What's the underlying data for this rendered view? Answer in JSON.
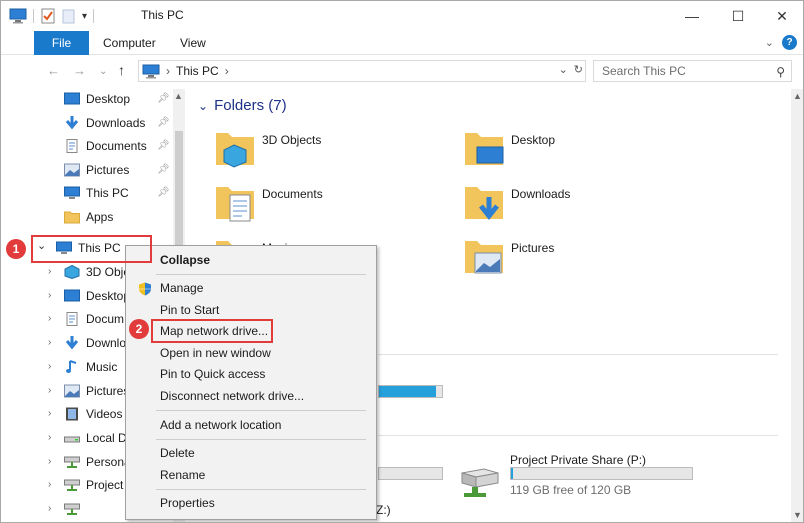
{
  "window": {
    "title": "This PC",
    "minimize": "—",
    "maximize": "☐",
    "close": "✕"
  },
  "ribbon": {
    "tabs": [
      "File",
      "Computer",
      "View"
    ]
  },
  "address": {
    "crumb": "This PC",
    "search_placeholder": "Search This PC"
  },
  "nav_pane": {
    "quick_access": [
      {
        "label": "Desktop",
        "icon": "desktop-icon"
      },
      {
        "label": "Downloads",
        "icon": "download-icon"
      },
      {
        "label": "Documents",
        "icon": "documents-icon"
      },
      {
        "label": "Pictures",
        "icon": "pictures-icon"
      },
      {
        "label": "This PC",
        "icon": "computer-icon"
      },
      {
        "label": "Apps",
        "icon": "folder-icon"
      }
    ],
    "this_pc": {
      "label": "This PC",
      "icon": "computer-icon"
    },
    "children": [
      {
        "label": "3D Obje",
        "icon": "3d-objects-icon"
      },
      {
        "label": "Desktop",
        "icon": "desktop-icon"
      },
      {
        "label": "Docum",
        "icon": "documents-icon"
      },
      {
        "label": "Downlo",
        "icon": "download-icon"
      },
      {
        "label": "Music",
        "icon": "music-icon"
      },
      {
        "label": "Pictures",
        "icon": "pictures-icon"
      },
      {
        "label": "Videos",
        "icon": "videos-icon"
      },
      {
        "label": "Local D",
        "icon": "drive-icon"
      },
      {
        "label": "Persona",
        "icon": "network-drive-icon"
      },
      {
        "label": "Project",
        "icon": "network-drive-icon"
      },
      {
        "label": "",
        "icon": "network-drive-icon"
      }
    ]
  },
  "content": {
    "folders_header": "Folders (7)",
    "folders": [
      {
        "label": "3D Objects"
      },
      {
        "label": "Desktop"
      },
      {
        "label": "Documents"
      },
      {
        "label": "Downloads"
      },
      {
        "label": "Music"
      },
      {
        "label": "Pictures"
      }
    ],
    "drive": {
      "label": "Project Private Share (P:)",
      "free_text": "119 GB free of 120 GB",
      "used_fraction": 0.008
    },
    "partial_bottom_text": "Z:)"
  },
  "context_menu": {
    "items": [
      "Collapse",
      "Manage",
      "Pin to Start",
      "Map network drive...",
      "Open in new window",
      "Pin to Quick access",
      "Disconnect network drive...",
      "Add a network location",
      "Delete",
      "Rename",
      "Properties"
    ]
  },
  "callouts": {
    "badge1": "1",
    "badge2": "2"
  },
  "colors": {
    "accent": "#1979ca",
    "callout": "#e23b3b",
    "folder": "#f2c55c"
  }
}
